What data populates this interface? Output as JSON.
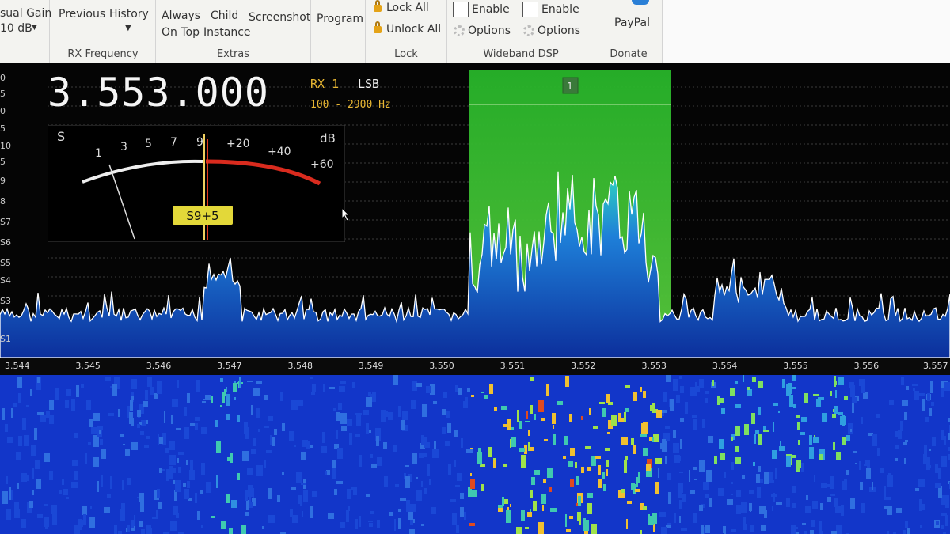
{
  "ribbon": {
    "audio_gain_label": "sual Gain",
    "audio_gain_value": "10 dB",
    "previous_label": "Previous",
    "history_label": "History",
    "rx_frequency_group": "RX Frequency",
    "always_label": "Always",
    "on_top_label": "On Top",
    "child_label": "Child",
    "instance_label": "Instance",
    "screenshot_label": "Screenshot",
    "extras_group": "Extras",
    "program_label": "Program",
    "lock_all_label": "Lock All",
    "unlock_all_label": "Unlock All",
    "lock_group": "Lock",
    "enable_label_1": "Enable",
    "options_label_1": "Options",
    "enable_label_2": "Enable",
    "options_label_2": "Options",
    "wideband_group": "Wideband DSP",
    "paypal_label": "PayPal",
    "donate_group": "Donate"
  },
  "display": {
    "frequency": "3.553.000",
    "rx": "RX 1",
    "mode": "LSB",
    "bandwidth": "100 - 2900 Hz",
    "filter_marker": "1"
  },
  "smeter": {
    "s_label": "S",
    "db_label": "dB",
    "scale_s": [
      "1",
      "3",
      "5",
      "7",
      "9"
    ],
    "scale_db": [
      "+20",
      "+40",
      "+60"
    ],
    "reading": "S9+5",
    "reading_level": 0.5
  },
  "side_scale": [
    "0",
    "5",
    "0",
    "5",
    "10",
    "5",
    "9",
    "8",
    "S7",
    "S6",
    "S5",
    "S4",
    "S3",
    "S1"
  ],
  "freq_axis": {
    "ticks": [
      "3.544",
      "3.545",
      "3.546",
      "3.547",
      "3.548",
      "3.549",
      "3.550",
      "3.551",
      "3.552",
      "3.553",
      "3.554",
      "3.555",
      "3.556",
      "3.557"
    ]
  },
  "colors": {
    "accent": "#e8b733",
    "passband": "#3fbf2a",
    "spectrum_line": "#ffffff",
    "waterfall_bg": "#1236c9"
  }
}
